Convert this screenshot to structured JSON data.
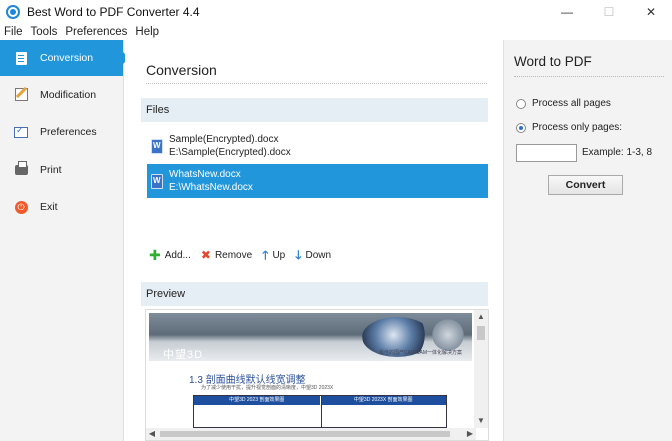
{
  "window": {
    "title": "Best Word to PDF Converter 4.4",
    "controls": {
      "minimize": "—",
      "maximize": "☐",
      "close": "✕"
    }
  },
  "menu": [
    "File",
    "Tools",
    "Preferences",
    "Help"
  ],
  "sidebar": {
    "items": [
      {
        "label": "Conversion",
        "icon": "document-icon",
        "active": true
      },
      {
        "label": "Modification",
        "icon": "pencil-icon"
      },
      {
        "label": "Preferences",
        "icon": "checklist-icon"
      },
      {
        "label": "Print",
        "icon": "printer-icon"
      },
      {
        "label": "Exit",
        "icon": "power-icon"
      }
    ]
  },
  "main": {
    "title": "Conversion",
    "files_header": "Files",
    "files": [
      {
        "name": "Sample(Encrypted).docx",
        "path": "E:\\Sample(Encrypted).docx",
        "selected": false
      },
      {
        "name": "WhatsNew.docx",
        "path": "E:\\WhatsNew.docx",
        "selected": true
      }
    ],
    "toolbar": {
      "add": "Add...",
      "remove": "Remove",
      "up": "Up",
      "down": "Down"
    },
    "preview_header": "Preview",
    "preview": {
      "logo": "中望3D",
      "banner_sub": "最佳的国产CAD/CAM一体化解决方案",
      "heading": "1.3 剖面曲线默认线宽调整",
      "subline": "为了减少使用干扰，提升视觉剖面的清晰度，中望3D 2023X",
      "table_cols": [
        "中望3D 2023 剖面效果图",
        "中望3D 2023X 剖面效果图"
      ]
    }
  },
  "right": {
    "title": "Word to PDF",
    "radio_all": "Process all pages",
    "radio_only": "Process only pages:",
    "pages_value": "",
    "example": "Example: 1-3, 8",
    "convert": "Convert"
  },
  "colors": {
    "accent": "#2196db",
    "section_bg": "#e6eef5",
    "sidebar_bg": "#f3f3f3"
  }
}
